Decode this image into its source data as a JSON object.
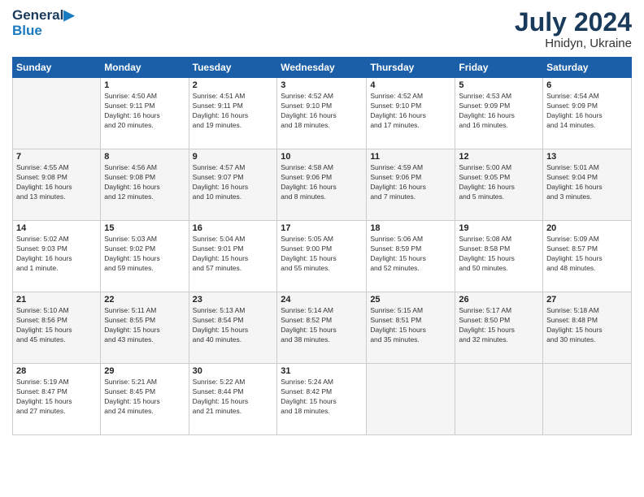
{
  "logo": {
    "line1": "General",
    "line2": "Blue"
  },
  "title": {
    "month_year": "July 2024",
    "location": "Hnidyn, Ukraine"
  },
  "weekdays": [
    "Sunday",
    "Monday",
    "Tuesday",
    "Wednesday",
    "Thursday",
    "Friday",
    "Saturday"
  ],
  "weeks": [
    [
      {
        "day": "",
        "info": ""
      },
      {
        "day": "1",
        "info": "Sunrise: 4:50 AM\nSunset: 9:11 PM\nDaylight: 16 hours\nand 20 minutes."
      },
      {
        "day": "2",
        "info": "Sunrise: 4:51 AM\nSunset: 9:11 PM\nDaylight: 16 hours\nand 19 minutes."
      },
      {
        "day": "3",
        "info": "Sunrise: 4:52 AM\nSunset: 9:10 PM\nDaylight: 16 hours\nand 18 minutes."
      },
      {
        "day": "4",
        "info": "Sunrise: 4:52 AM\nSunset: 9:10 PM\nDaylight: 16 hours\nand 17 minutes."
      },
      {
        "day": "5",
        "info": "Sunrise: 4:53 AM\nSunset: 9:09 PM\nDaylight: 16 hours\nand 16 minutes."
      },
      {
        "day": "6",
        "info": "Sunrise: 4:54 AM\nSunset: 9:09 PM\nDaylight: 16 hours\nand 14 minutes."
      }
    ],
    [
      {
        "day": "7",
        "info": "Sunrise: 4:55 AM\nSunset: 9:08 PM\nDaylight: 16 hours\nand 13 minutes."
      },
      {
        "day": "8",
        "info": "Sunrise: 4:56 AM\nSunset: 9:08 PM\nDaylight: 16 hours\nand 12 minutes."
      },
      {
        "day": "9",
        "info": "Sunrise: 4:57 AM\nSunset: 9:07 PM\nDaylight: 16 hours\nand 10 minutes."
      },
      {
        "day": "10",
        "info": "Sunrise: 4:58 AM\nSunset: 9:06 PM\nDaylight: 16 hours\nand 8 minutes."
      },
      {
        "day": "11",
        "info": "Sunrise: 4:59 AM\nSunset: 9:06 PM\nDaylight: 16 hours\nand 7 minutes."
      },
      {
        "day": "12",
        "info": "Sunrise: 5:00 AM\nSunset: 9:05 PM\nDaylight: 16 hours\nand 5 minutes."
      },
      {
        "day": "13",
        "info": "Sunrise: 5:01 AM\nSunset: 9:04 PM\nDaylight: 16 hours\nand 3 minutes."
      }
    ],
    [
      {
        "day": "14",
        "info": "Sunrise: 5:02 AM\nSunset: 9:03 PM\nDaylight: 16 hours\nand 1 minute."
      },
      {
        "day": "15",
        "info": "Sunrise: 5:03 AM\nSunset: 9:02 PM\nDaylight: 15 hours\nand 59 minutes."
      },
      {
        "day": "16",
        "info": "Sunrise: 5:04 AM\nSunset: 9:01 PM\nDaylight: 15 hours\nand 57 minutes."
      },
      {
        "day": "17",
        "info": "Sunrise: 5:05 AM\nSunset: 9:00 PM\nDaylight: 15 hours\nand 55 minutes."
      },
      {
        "day": "18",
        "info": "Sunrise: 5:06 AM\nSunset: 8:59 PM\nDaylight: 15 hours\nand 52 minutes."
      },
      {
        "day": "19",
        "info": "Sunrise: 5:08 AM\nSunset: 8:58 PM\nDaylight: 15 hours\nand 50 minutes."
      },
      {
        "day": "20",
        "info": "Sunrise: 5:09 AM\nSunset: 8:57 PM\nDaylight: 15 hours\nand 48 minutes."
      }
    ],
    [
      {
        "day": "21",
        "info": "Sunrise: 5:10 AM\nSunset: 8:56 PM\nDaylight: 15 hours\nand 45 minutes."
      },
      {
        "day": "22",
        "info": "Sunrise: 5:11 AM\nSunset: 8:55 PM\nDaylight: 15 hours\nand 43 minutes."
      },
      {
        "day": "23",
        "info": "Sunrise: 5:13 AM\nSunset: 8:54 PM\nDaylight: 15 hours\nand 40 minutes."
      },
      {
        "day": "24",
        "info": "Sunrise: 5:14 AM\nSunset: 8:52 PM\nDaylight: 15 hours\nand 38 minutes."
      },
      {
        "day": "25",
        "info": "Sunrise: 5:15 AM\nSunset: 8:51 PM\nDaylight: 15 hours\nand 35 minutes."
      },
      {
        "day": "26",
        "info": "Sunrise: 5:17 AM\nSunset: 8:50 PM\nDaylight: 15 hours\nand 32 minutes."
      },
      {
        "day": "27",
        "info": "Sunrise: 5:18 AM\nSunset: 8:48 PM\nDaylight: 15 hours\nand 30 minutes."
      }
    ],
    [
      {
        "day": "28",
        "info": "Sunrise: 5:19 AM\nSunset: 8:47 PM\nDaylight: 15 hours\nand 27 minutes."
      },
      {
        "day": "29",
        "info": "Sunrise: 5:21 AM\nSunset: 8:45 PM\nDaylight: 15 hours\nand 24 minutes."
      },
      {
        "day": "30",
        "info": "Sunrise: 5:22 AM\nSunset: 8:44 PM\nDaylight: 15 hours\nand 21 minutes."
      },
      {
        "day": "31",
        "info": "Sunrise: 5:24 AM\nSunset: 8:42 PM\nDaylight: 15 hours\nand 18 minutes."
      },
      {
        "day": "",
        "info": ""
      },
      {
        "day": "",
        "info": ""
      },
      {
        "day": "",
        "info": ""
      }
    ]
  ]
}
